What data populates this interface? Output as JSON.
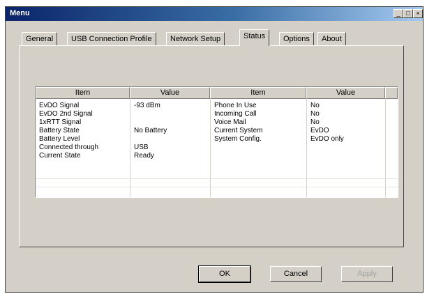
{
  "window": {
    "title": "Menu",
    "minimize": "_",
    "maximize": "□",
    "close": "×"
  },
  "tabs": [
    {
      "label": "General"
    },
    {
      "label": "USB Connection Profile"
    },
    {
      "label": "Network Setup"
    },
    {
      "label": "Status"
    },
    {
      "label": "Options"
    },
    {
      "label": "About"
    }
  ],
  "table": {
    "headers": [
      "Item",
      "Value",
      "Item",
      "Value"
    ],
    "left_rows": [
      {
        "item": "EvDO Signal",
        "value": "-93 dBm"
      },
      {
        "item": "EvDO 2nd Signal",
        "value": ""
      },
      {
        "item": "1xRTT Signal",
        "value": ""
      },
      {
        "item": "Battery State",
        "value": "No Battery"
      },
      {
        "item": "Battery Level",
        "value": ""
      },
      {
        "item": "Connected through",
        "value": "USB"
      },
      {
        "item": "Current State",
        "value": "Ready"
      }
    ],
    "right_rows": [
      {
        "item": "Phone In Use",
        "value": "No"
      },
      {
        "item": "Incoming Call",
        "value": "No"
      },
      {
        "item": "Voice Mail",
        "value": "No"
      },
      {
        "item": "Current System",
        "value": "EvDO"
      },
      {
        "item": "System Config.",
        "value": "EvDO only"
      }
    ]
  },
  "buttons": {
    "ok": "OK",
    "cancel": "Cancel",
    "apply": "Apply"
  }
}
